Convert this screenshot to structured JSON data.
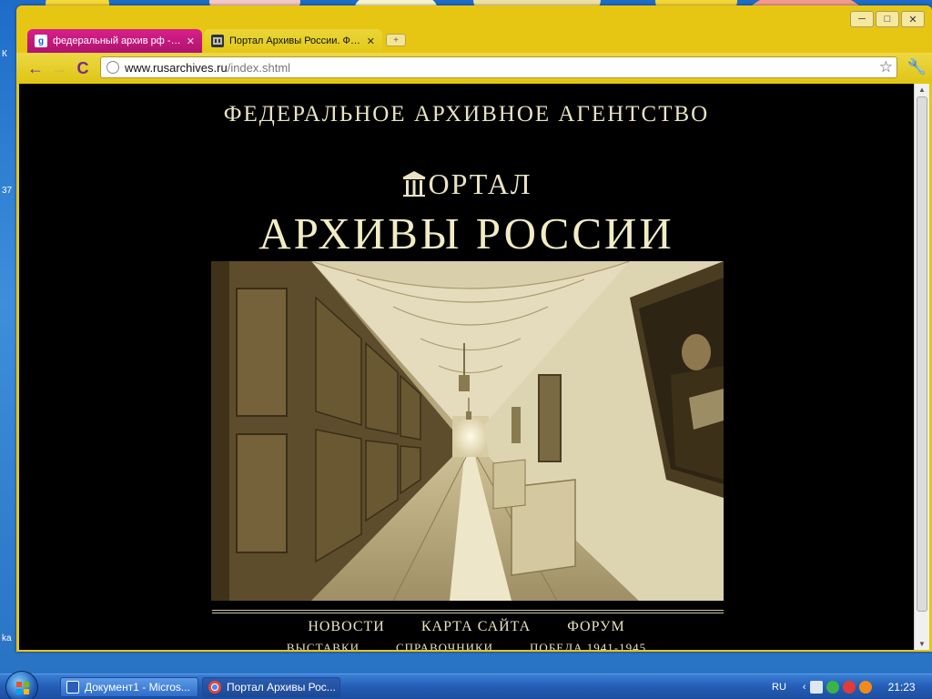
{
  "desktop": {
    "side_labels": [
      "К",
      "37",
      "ka"
    ]
  },
  "browser": {
    "tabs": [
      {
        "title": "федеральный архив рф - Поі",
        "active": false,
        "favicon_text": "g"
      },
      {
        "title": "Портал Архивы России. Феде",
        "active": true,
        "favicon_text": ""
      }
    ],
    "new_tab_label": "+",
    "window_controls": {
      "minimize": "─",
      "maximize": "□",
      "close": "✕"
    },
    "nav": {
      "back": "←",
      "forward": "→",
      "reload": "C"
    },
    "address": {
      "host": "www.rusarchives.ru",
      "path": "/index.shtml"
    },
    "bookmark_icon": "☆",
    "menu_icon": "🔧"
  },
  "page": {
    "agency_title": "ФЕДЕРАЛЬНОЕ АРХИВНОЕ АГЕНТСТВО",
    "portal_title_rest": "ОРТАЛ",
    "archives_title": "АРХИВЫ РОССИИ",
    "menu_primary": [
      "НОВОСТИ",
      "КАРТА САЙТА",
      "ФОРУМ"
    ],
    "menu_secondary": [
      "ВЫСТАВКИ",
      "СПРАВОЧНИКИ",
      "ПОБЕДА.1941-1945"
    ]
  },
  "taskbar": {
    "tasks": [
      {
        "label": "Документ1 - Micros...",
        "active": false
      },
      {
        "label": "Портал Архивы Рос...",
        "active": true
      }
    ],
    "language": "RU",
    "clock": "21:23"
  }
}
